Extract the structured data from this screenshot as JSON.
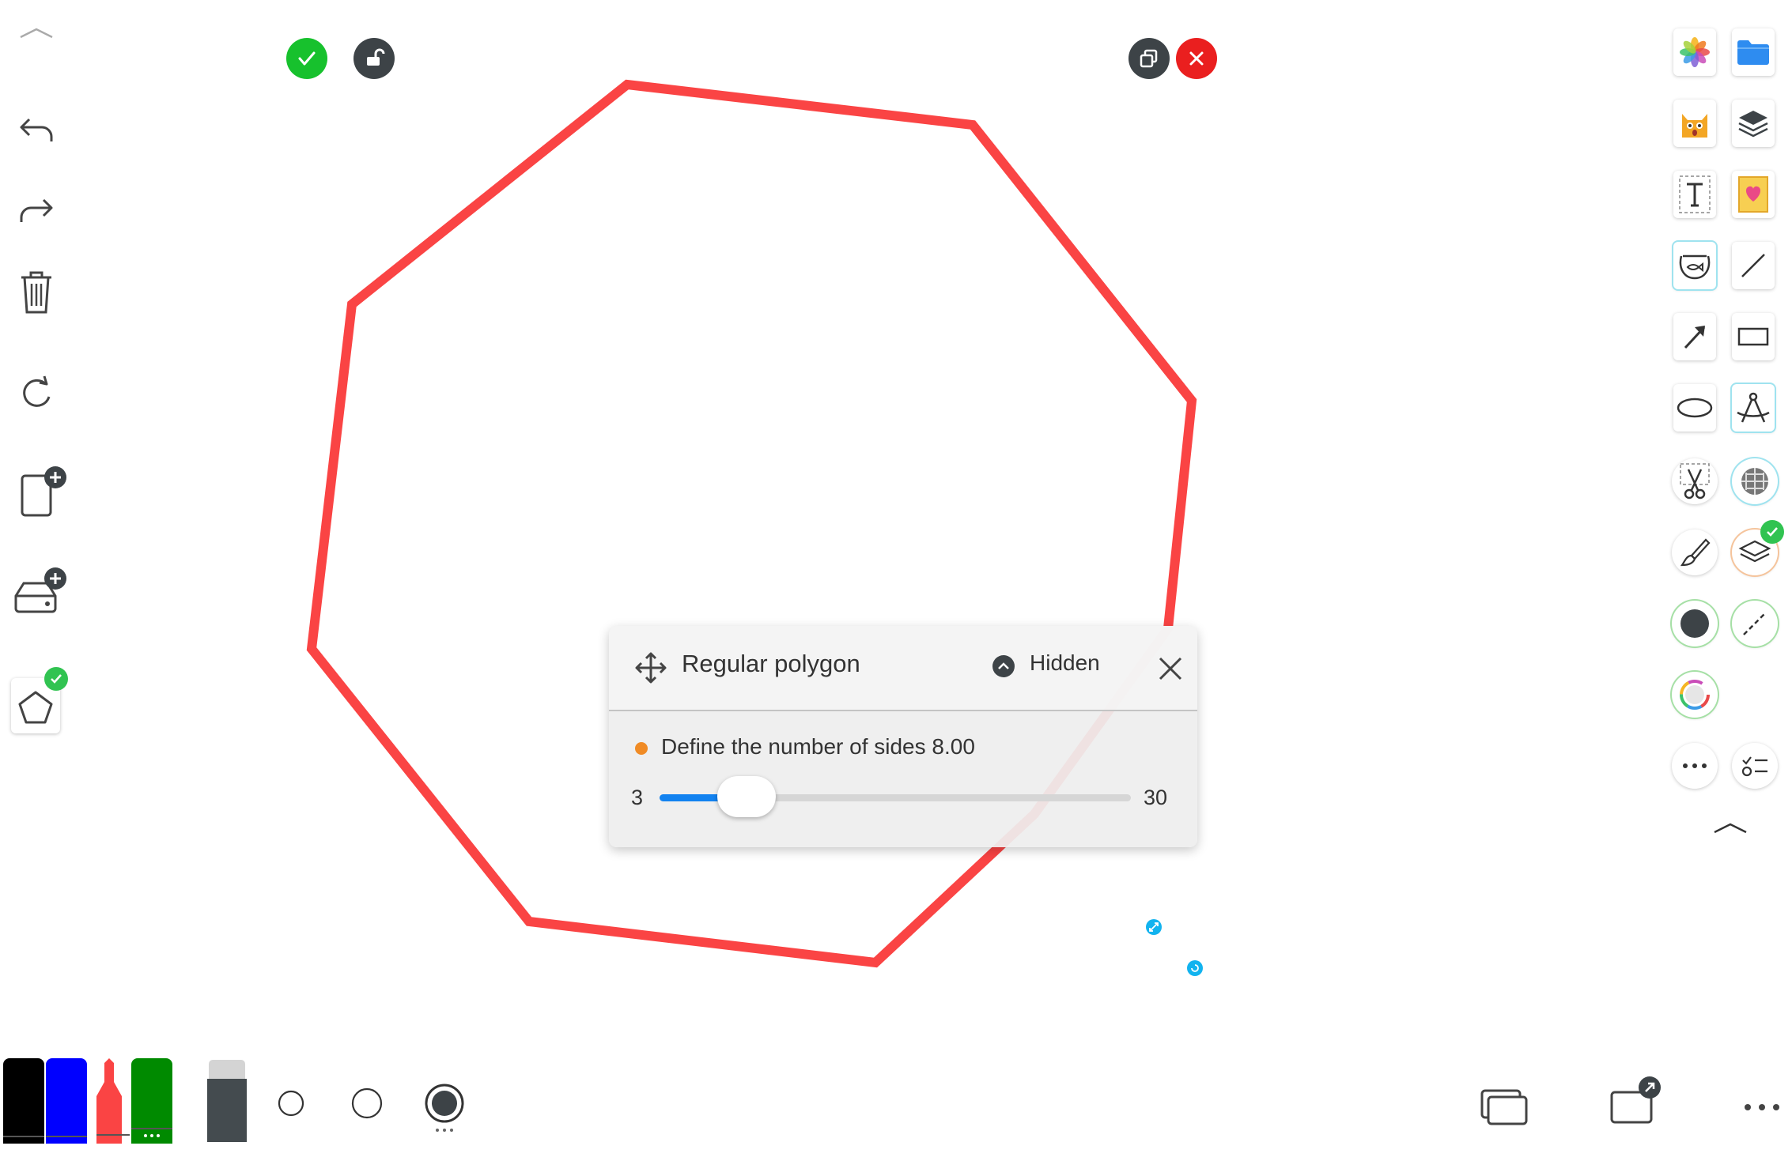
{
  "canvas": {
    "shape": "regular-octagon",
    "stroke_color": "#fa4444"
  },
  "top_bar": {
    "confirm_icon": "check-icon",
    "lock_icon": "unlock-icon",
    "duplicate_icon": "duplicate-icon",
    "delete_icon": "close-icon",
    "confirm_color": "#17c12d",
    "delete_color": "#ea1f1f"
  },
  "left_toolbar": {
    "items": [
      "collapse-icon",
      "undo-icon",
      "redo-icon",
      "trash-icon",
      "rotate-icon",
      "add-page-icon",
      "add-storage-icon",
      "pentagon-icon"
    ]
  },
  "polygon_dialog": {
    "title": "Regular polygon",
    "hidden_label": "Hidden",
    "sides_label": "Define the number of sides 8.00",
    "min_label": "3",
    "max_label": "30",
    "min": 3,
    "max": 30,
    "value": 8,
    "accent": "#1282f0",
    "dot_color": "#f08b25"
  },
  "right_toolbar": {
    "items": [
      "photos-icon",
      "folder-icon",
      "cat-sticker-icon",
      "layers-icon",
      "text-icon",
      "sticker-card-icon",
      "fishbowl-icon",
      "line-icon",
      "arrow-icon",
      "rectangle-icon",
      "ellipse-icon",
      "compass-icon",
      "scissors-icon",
      "grid-globe-icon",
      "brush-icon",
      "layer-toggle-icon",
      "fill-circle-icon",
      "dashed-line-icon",
      "color-wheel-icon",
      "more-icon",
      "list-icon",
      "expand-icon"
    ]
  },
  "bottom_bar": {
    "pens": [
      {
        "name": "black-marker",
        "color": "#000000"
      },
      {
        "name": "blue-marker",
        "color": "#0000ff"
      },
      {
        "name": "red-marker",
        "color": "#fa4444"
      },
      {
        "name": "green-marker",
        "color": "#008a00"
      }
    ],
    "eraser_color": "#444b4f",
    "sizes": [
      "size-small",
      "size-medium",
      "size-large"
    ],
    "right_icons": [
      "pages-icon",
      "share-icon",
      "more-icon"
    ]
  }
}
